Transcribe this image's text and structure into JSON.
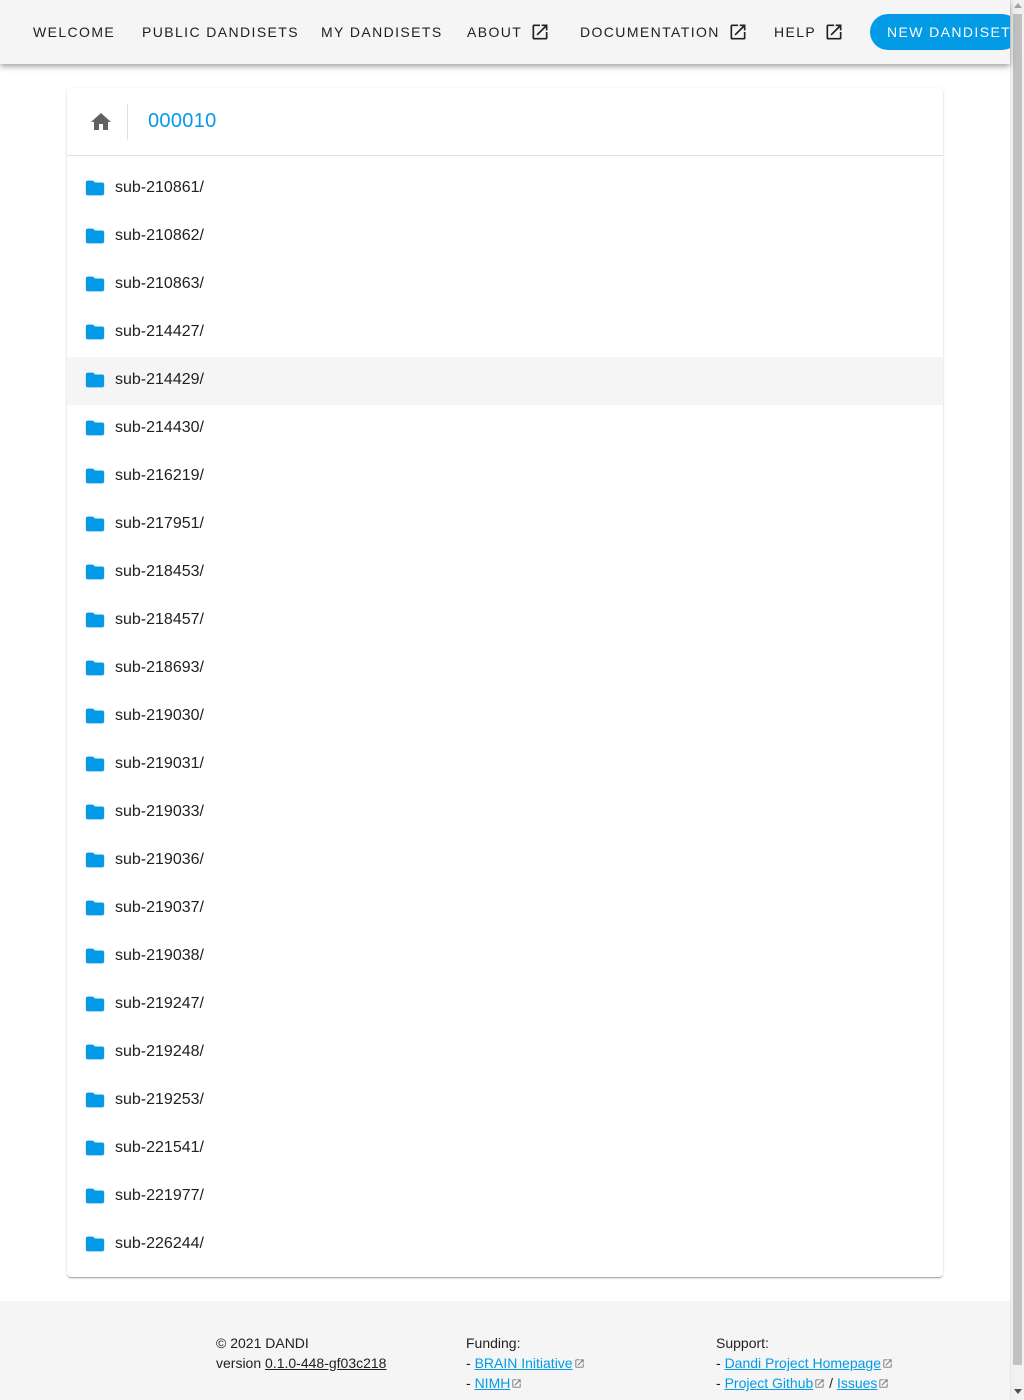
{
  "nav": {
    "welcome": "WELCOME",
    "public_dandisets": "PUBLIC DANDISETS",
    "my_dandisets": "MY DANDISETS",
    "about": "ABOUT",
    "documentation": "DOCUMENTATION",
    "help": "HELP",
    "new_dandiset": "NEW DANDISET",
    "external_icon": "open-in-new-icon"
  },
  "browser": {
    "home_icon": "home-icon",
    "dandiset_id": "000010",
    "folder_icon": "folder-icon",
    "folder_color": "#039be5",
    "hovered_index": 4,
    "items": [
      "sub-210861/",
      "sub-210862/",
      "sub-210863/",
      "sub-214427/",
      "sub-214429/",
      "sub-214430/",
      "sub-216219/",
      "sub-217951/",
      "sub-218453/",
      "sub-218457/",
      "sub-218693/",
      "sub-219030/",
      "sub-219031/",
      "sub-219033/",
      "sub-219036/",
      "sub-219037/",
      "sub-219038/",
      "sub-219247/",
      "sub-219248/",
      "sub-219253/",
      "sub-221541/",
      "sub-221977/",
      "sub-226244/"
    ]
  },
  "footer": {
    "copyright": "© 2021 DANDI",
    "version_prefix": "version ",
    "version": "0.1.0-448-gf03c218",
    "funding_label": "Funding:",
    "funding_links": [
      "BRAIN Initiative",
      "NIMH"
    ],
    "support_label": "Support:",
    "support_homepage": "Dandi Project Homepage",
    "support_github": "Project Github",
    "support_sep": " / ",
    "support_issues": "Issues",
    "dash": "- "
  },
  "colors": {
    "accent": "#039be5",
    "appbar_bg": "#f5f5f5",
    "hover_row": "#f5f5f5"
  }
}
